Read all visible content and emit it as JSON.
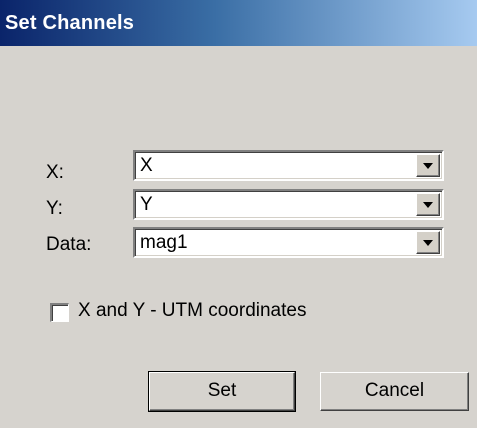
{
  "window": {
    "title": "Set Channels"
  },
  "fields": [
    {
      "label": "X:",
      "value": "X"
    },
    {
      "label": "Y:",
      "value": "Y"
    },
    {
      "label": "Data:",
      "value": "mag1"
    }
  ],
  "checkbox": {
    "label": "X and Y - UTM coordinates",
    "checked": false
  },
  "buttons": {
    "set_label": "Set",
    "cancel_label": "Cancel"
  },
  "icons": {
    "dropdown": "chevron-down-icon"
  },
  "colors": {
    "dialog_bg": "#d6d3ce",
    "title_start": "#0a246a",
    "title_end": "#a6caf0"
  }
}
